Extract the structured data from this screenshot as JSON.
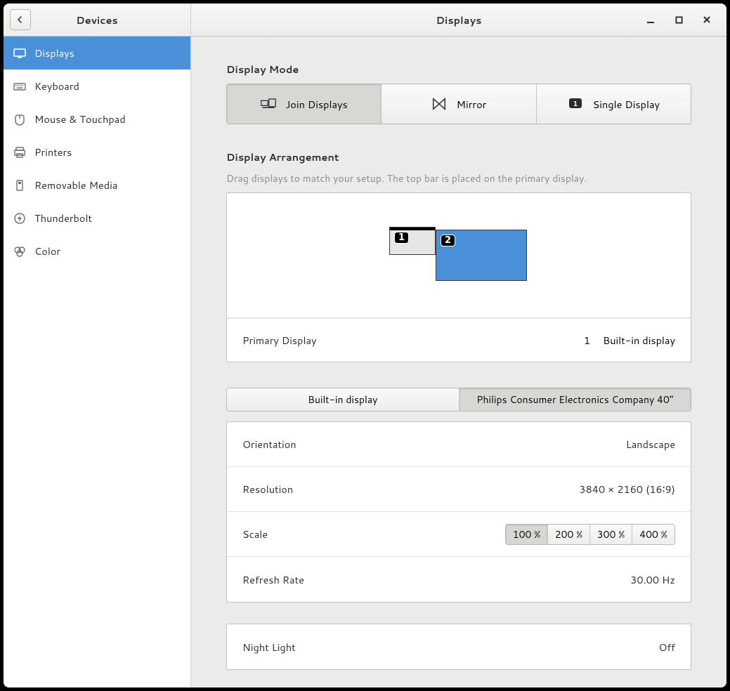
{
  "header": {
    "devices_label": "Devices",
    "page_title": "Displays"
  },
  "sidebar": {
    "items": [
      {
        "label": "Displays"
      },
      {
        "label": "Keyboard"
      },
      {
        "label": "Mouse & Touchpad"
      },
      {
        "label": "Printers"
      },
      {
        "label": "Removable Media"
      },
      {
        "label": "Thunderbolt"
      },
      {
        "label": "Color"
      }
    ]
  },
  "display_mode": {
    "title": "Display Mode",
    "join": "Join Displays",
    "mirror": "Mirror",
    "single": "Single Display"
  },
  "arrangement": {
    "title": "Display Arrangement",
    "hint": "Drag displays to match your setup. The top bar is placed on the primary display.",
    "badge1": "1",
    "badge2": "2",
    "primary_label": "Primary Display",
    "primary_num": "1",
    "primary_name": "Built-in display"
  },
  "display_selector": {
    "d1": "Built-in display",
    "d2": "Philips Consumer Electronics Company 40\""
  },
  "settings": {
    "orientation_label": "Orientation",
    "orientation_value": "Landscape",
    "resolution_label": "Resolution",
    "resolution_value": "3840 × 2160 (16∶9)",
    "scale_label": "Scale",
    "scale_100": "100 %",
    "scale_200": "200 %",
    "scale_300": "300 %",
    "scale_400": "400 %",
    "refresh_label": "Refresh Rate",
    "refresh_value": "30.00 Hz"
  },
  "night_light": {
    "label": "Night Light",
    "value": "Off"
  }
}
